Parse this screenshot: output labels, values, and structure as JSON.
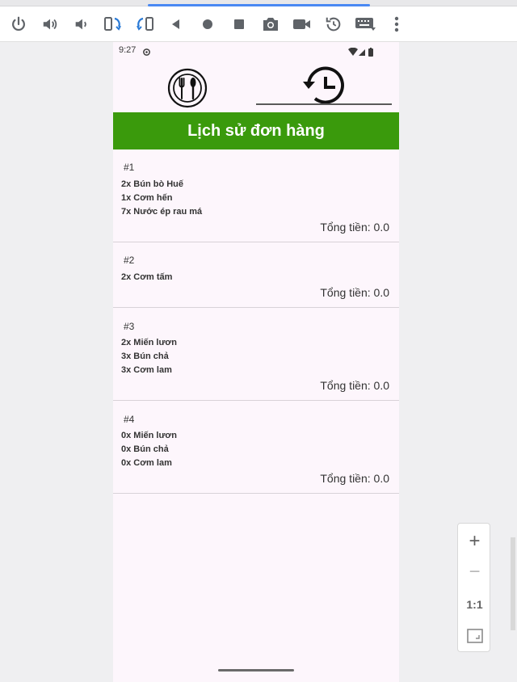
{
  "toolbar": {
    "buttons": [
      "power-icon",
      "volume-up-icon",
      "volume-down-icon",
      "rotate-left-icon",
      "rotate-right-icon",
      "back-icon",
      "home-icon",
      "overview-icon",
      "screenshot-icon",
      "screenrecord-icon",
      "snapshot-icon",
      "keyboard-icon",
      "more-icon"
    ]
  },
  "status": {
    "time": "9:27"
  },
  "tabs": {
    "selected": "history"
  },
  "title": "Lịch sử đơn hàng",
  "orders": [
    {
      "id": "#1",
      "items": [
        "2x Bún bò Huế",
        "1x Cơm hến",
        "7x Nước ép rau má"
      ],
      "total": "Tổng tiền: 0.0"
    },
    {
      "id": "#2",
      "items": [
        "2x Cơm tấm"
      ],
      "total": "Tổng tiền: 0.0"
    },
    {
      "id": "#3",
      "items": [
        "2x Miến lươn",
        "3x Bún chả",
        "3x Cơm lam"
      ],
      "total": "Tổng tiền: 0.0"
    },
    {
      "id": "#4",
      "items": [
        "0x Miến lươn",
        "0x Bún chả",
        "0x Cơm lam"
      ],
      "total": "Tổng tiền: 0.0"
    }
  ],
  "zoom": {
    "in": "+",
    "out": "−",
    "reset": "1:1"
  },
  "colors": {
    "accent": "#3a9a0c",
    "screen_bg": "#fdf6fc",
    "icon_gray": "#5f6368"
  }
}
